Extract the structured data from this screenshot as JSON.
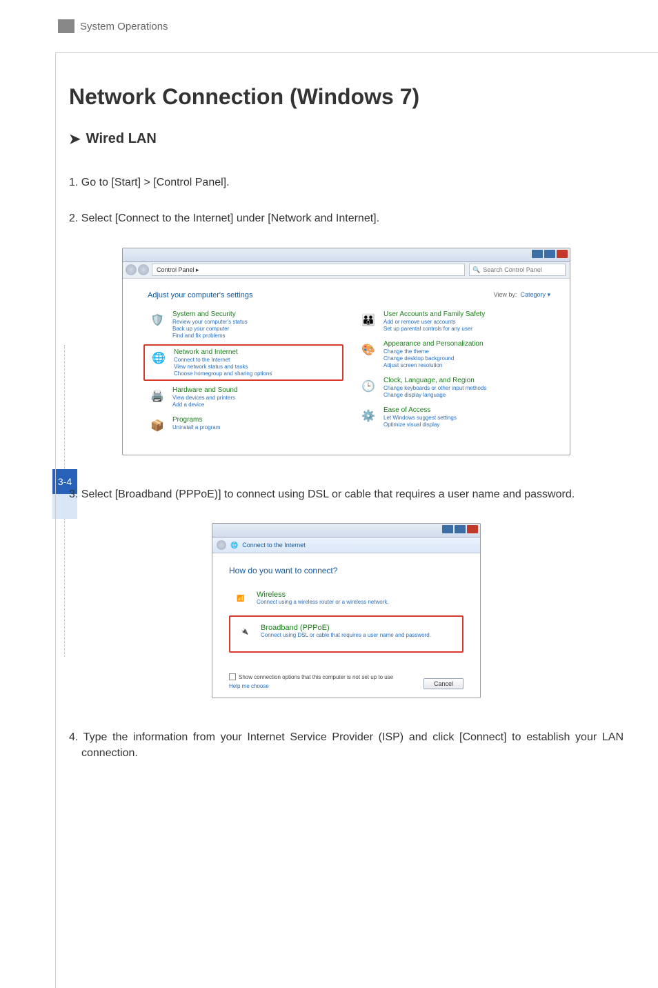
{
  "header": {
    "section": "System Operations"
  },
  "chapter": {
    "title": "Network Connection (Windows 7)"
  },
  "section": {
    "heading": "Wired LAN"
  },
  "steps": [
    {
      "num": "1.",
      "text": "Go to [Start] > [Control Panel]."
    },
    {
      "num": "2.",
      "text": "Select [Connect to the Internet] under [Network and Internet]."
    },
    {
      "num": "3.",
      "text": "Select [Broadband (PPPoE)] to connect using DSL or cable that requires a user name and password."
    },
    {
      "num": "4.",
      "text": "Type the information from your Internet Service Provider (ISP) and click [Connect] to establish your LAN connection."
    }
  ],
  "page_tab": "3-4",
  "shot1": {
    "crumb": "Control Panel  ▸",
    "search_placeholder": "Search Control Panel",
    "adjust": "Adjust your computer's settings",
    "view_by_label": "View by:",
    "view_by_value": "Category ▾",
    "left": [
      {
        "head": "System and Security",
        "links": [
          "Review your computer's status",
          "Back up your computer",
          "Find and fix problems"
        ],
        "ic": "🛡️"
      },
      {
        "head": "Network and Internet",
        "links": [
          "Connect to the Internet",
          "View network status and tasks",
          "Choose homegroup and sharing options"
        ],
        "ic": "🌐",
        "box": true
      },
      {
        "head": "Hardware and Sound",
        "links": [
          "View devices and printers",
          "Add a device"
        ],
        "ic": "🖨️"
      },
      {
        "head": "Programs",
        "links": [
          "Uninstall a program"
        ],
        "ic": "📦"
      }
    ],
    "right": [
      {
        "head": "User Accounts and Family Safety",
        "links": [
          "Add or remove user accounts",
          "Set up parental controls for any user"
        ],
        "ic": "👪"
      },
      {
        "head": "Appearance and Personalization",
        "links": [
          "Change the theme",
          "Change desktop background",
          "Adjust screen resolution"
        ],
        "ic": "🎨"
      },
      {
        "head": "Clock, Language, and Region",
        "links": [
          "Change keyboards or other input methods",
          "Change display language"
        ],
        "ic": "🕒"
      },
      {
        "head": "Ease of Access",
        "links": [
          "Let Windows suggest settings",
          "Optimize visual display"
        ],
        "ic": "⚙️"
      }
    ]
  },
  "shot2": {
    "crumb": "Connect to the Internet",
    "question": "How do you want to connect?",
    "opts": [
      {
        "title": "Wireless",
        "sub": "Connect using a wireless router or a wireless network.",
        "ic": "📶"
      },
      {
        "title": "Broadband (PPPoE)",
        "sub": "Connect using DSL or cable that requires a user name and password.",
        "ic": "🔌",
        "box": true
      }
    ],
    "show_more": "Show connection options that this computer is not set up to use",
    "help": "Help me choose",
    "cancel": "Cancel"
  }
}
